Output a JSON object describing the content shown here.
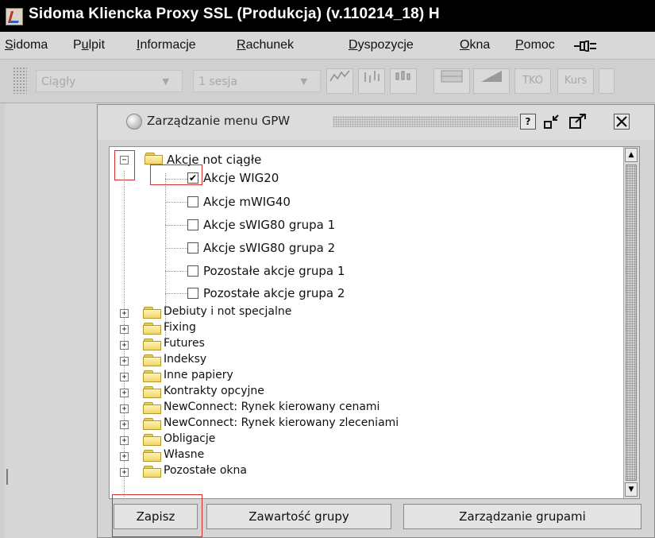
{
  "window": {
    "title": "Sidoma Kliencka Proxy SSL (Produkcja) (v.110214_18) H"
  },
  "menubar": {
    "items": [
      {
        "first": "S",
        "rest": "idoma"
      },
      {
        "first": "P",
        "rest": "ulpit",
        "prefix": ""
      },
      {
        "first": "I",
        "rest": "nformacje"
      },
      {
        "first": "R",
        "rest": "achunek"
      },
      {
        "first": "D",
        "rest": "yspozycje"
      },
      {
        "first": "O",
        "rest": "kna"
      },
      {
        "first": "P",
        "rest": "omoc"
      }
    ],
    "icon": "speaker-icon"
  },
  "toolbar": {
    "mode_value": "Ciągły",
    "session_value": "1 sesja",
    "tko_label": "TKO",
    "kurs_label": "Kurs",
    "icons": [
      "line-chart-icon",
      "bar-chart-icon",
      "candlestick-chart-icon",
      "grid-chart-icon",
      "area-chart-icon"
    ]
  },
  "frame": {
    "title": "Zarządzanie menu GPW",
    "help_label": "?",
    "buttons": [
      "help-icon",
      "restore-icon",
      "maximize-icon",
      "close-icon"
    ]
  },
  "tree": {
    "expanded_folder": {
      "label": "Akcje not ciągłe",
      "children": [
        {
          "label": "Akcje WIG20",
          "checked": true
        },
        {
          "label": "Akcje mWIG40",
          "checked": false
        },
        {
          "label": "Akcje sWIG80 grupa 1",
          "checked": false
        },
        {
          "label": "Akcje sWIG80 grupa 2",
          "checked": false
        },
        {
          "label": "Pozostałe akcje grupa 1",
          "checked": false
        },
        {
          "label": "Pozostałe akcje grupa 2",
          "checked": false
        }
      ]
    },
    "folders": [
      "Debiuty i not specjalne",
      "Fixing",
      "Futures",
      "Indeksy",
      "Inne papiery",
      "Kontrakty opcyjne",
      "NewConnect: Rynek kierowany cenami",
      "NewConnect: Rynek kierowany zleceniami",
      "Obligacje",
      "Własne",
      "Pozostałe okna"
    ]
  },
  "buttons": {
    "save": "Zapisz",
    "group_contents": "Zawartość grupy",
    "group_management": "Zarządzanie grupami"
  },
  "colors": {
    "highlight": "#d03030",
    "folder": "#f1d66c",
    "titlebar": "#000000"
  }
}
